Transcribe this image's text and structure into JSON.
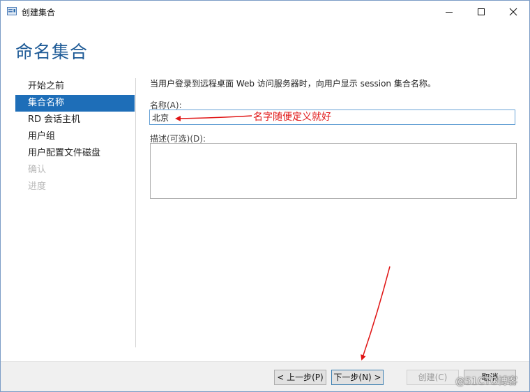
{
  "window": {
    "title": "创建集合",
    "controls": {
      "minimize": "—",
      "maximize": "☐",
      "close": "✕"
    }
  },
  "header": {
    "title": "命名集合"
  },
  "sidebar": {
    "items": [
      {
        "label": "开始之前",
        "state": "normal"
      },
      {
        "label": "集合名称",
        "state": "active"
      },
      {
        "label": "RD 会话主机",
        "state": "normal"
      },
      {
        "label": "用户组",
        "state": "normal"
      },
      {
        "label": "用户配置文件磁盘",
        "state": "normal"
      },
      {
        "label": "确认",
        "state": "disabled"
      },
      {
        "label": "进度",
        "state": "disabled"
      }
    ]
  },
  "main": {
    "description": "当用户登录到远程桌面 Web 访问服务器时，向用户显示 session 集合名称。",
    "name_label": "名称(A):",
    "name_value": "北京",
    "desc_label": "描述(可选)(D):",
    "desc_value": ""
  },
  "annotation": {
    "text": "名字随便定义就好",
    "color": "#e01515"
  },
  "footer": {
    "prev_label": "< 上一步(P)",
    "next_label": "下一步(N) >",
    "create_label": "创建(C)",
    "cancel_label": "取消"
  },
  "watermark": {
    "text": "@51CTO博客"
  },
  "colors": {
    "accent": "#1e6eb8",
    "title": "#1d5a96",
    "annotation": "#e01515"
  }
}
